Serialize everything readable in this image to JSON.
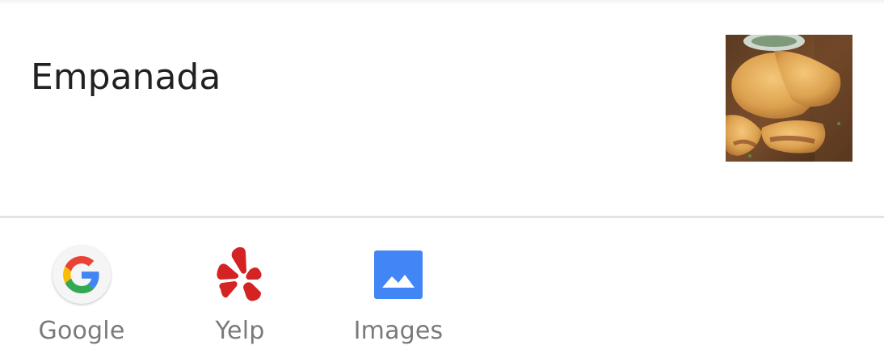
{
  "entity": {
    "title": "Empanada",
    "thumbnail_icon": "empanada-photo"
  },
  "actions": [
    {
      "label": "Google",
      "icon": "google-icon"
    },
    {
      "label": "Yelp",
      "icon": "yelp-icon"
    },
    {
      "label": "Images",
      "icon": "images-icon"
    }
  ],
  "colors": {
    "google_blue": "#4285F4",
    "google_red": "#EA4335",
    "google_yellow": "#FBBC05",
    "google_green": "#34A853",
    "yelp_red": "#D32323",
    "images_blue": "#4285F4",
    "label_gray": "#7a7a7a"
  }
}
